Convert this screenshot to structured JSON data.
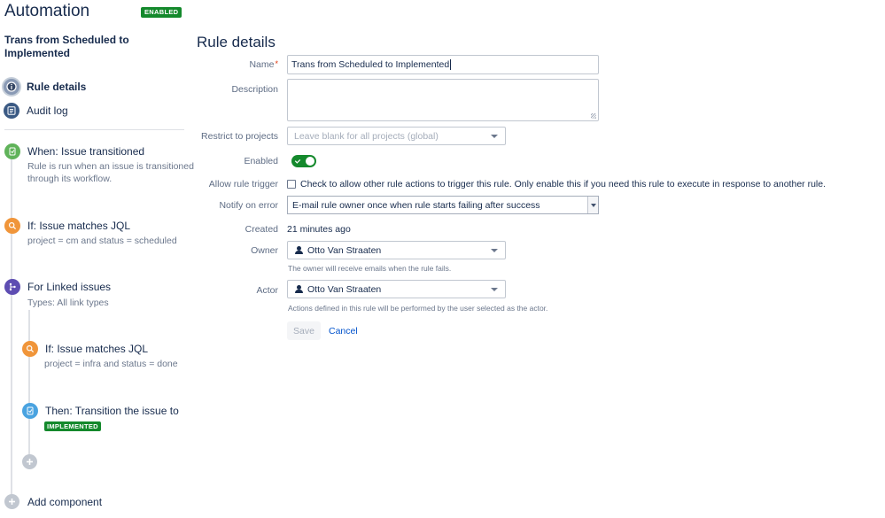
{
  "header": {
    "app_title": "Automation",
    "status_badge": "ENABLED"
  },
  "sidebar": {
    "rule_name": "Trans from Scheduled to Implemented",
    "nav": [
      {
        "label": "Rule details",
        "icon": "info-icon",
        "active": true
      },
      {
        "label": "Audit log",
        "icon": "audit-log-icon",
        "active": false
      }
    ],
    "components": [
      {
        "title": "When: Issue transitioned",
        "desc": "Rule is run when an issue is transitioned\nthrough its workflow.",
        "icon": "trigger-icon",
        "color": "#60b35a"
      },
      {
        "title": "If: Issue matches JQL",
        "desc": "project = cm and status = scheduled",
        "icon": "search-icon",
        "color": "#f0953a"
      },
      {
        "title": "For Linked issues",
        "desc": "Types: All link types",
        "icon": "branch-icon",
        "color": "#5e4db2"
      },
      {
        "title": "If: Issue matches JQL",
        "desc": "project = infra and status = done",
        "icon": "search-icon",
        "color": "#f0953a"
      },
      {
        "title": "Then: Transition the issue to",
        "badge": "IMPLEMENTED",
        "icon": "action-icon",
        "color": "#4aa3e0"
      }
    ],
    "add_component": "Add component"
  },
  "main": {
    "title": "Rule details",
    "form": {
      "name_label": "Name",
      "name_value": "Trans from Scheduled to Implemented",
      "description_label": "Description",
      "description_value": "",
      "restrict_label": "Restrict to projects",
      "restrict_placeholder": "Leave blank for all projects (global)",
      "enabled_label": "Enabled",
      "enabled": true,
      "allow_trigger_label": "Allow rule trigger",
      "allow_trigger_text": "Check to allow other rule actions to trigger this rule. Only enable this if you need this rule to execute in response to another rule.",
      "notify_label": "Notify on error",
      "notify_value": "E-mail rule owner once when rule starts failing after success",
      "created_label": "Created",
      "created_value": "21 minutes ago",
      "owner_label": "Owner",
      "owner_value": "Otto Van Straaten",
      "owner_help": "The owner will receive emails when the rule fails.",
      "actor_label": "Actor",
      "actor_value": "Otto Van Straaten",
      "actor_help": "Actions defined in this rule will be performed by the user selected as the actor.",
      "save_label": "Save",
      "cancel_label": "Cancel"
    }
  }
}
